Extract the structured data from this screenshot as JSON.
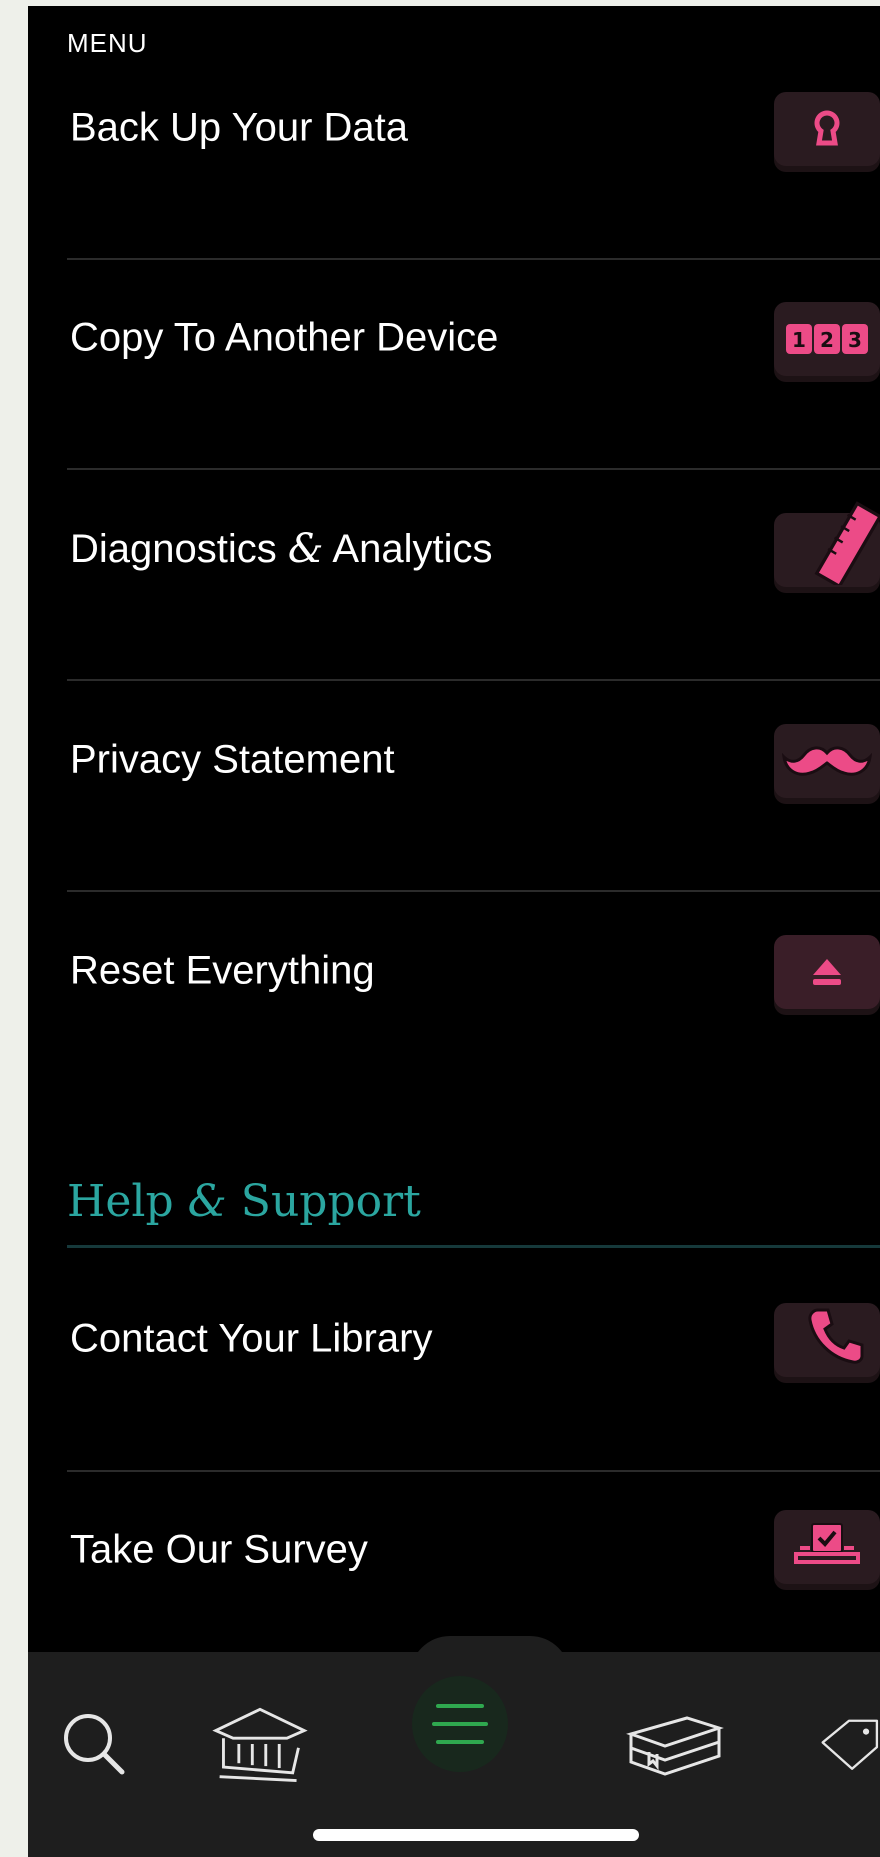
{
  "menu": {
    "title": "MENU"
  },
  "settings_items": [
    {
      "label": "Back Up Your Data",
      "icon": "keyhole-icon"
    },
    {
      "label": "Copy To Another Device",
      "icon": "numbers-123-icon"
    },
    {
      "label": "Diagnostics & Analytics",
      "icon": "ruler-icon"
    },
    {
      "label": "Privacy Statement",
      "icon": "mustache-icon"
    },
    {
      "label": "Reset Everything",
      "icon": "eject-icon"
    }
  ],
  "help_section": {
    "title": "Help & Support",
    "items": [
      {
        "label": "Contact Your Library",
        "icon": "phone-icon"
      },
      {
        "label": "Take Our Survey",
        "icon": "ballot-box-icon"
      }
    ]
  },
  "tab_bar": {
    "tabs": [
      {
        "icon": "search-icon"
      },
      {
        "icon": "library-icon"
      },
      {
        "icon": "menu-icon",
        "active": true
      },
      {
        "icon": "books-icon"
      },
      {
        "icon": "tag-icon"
      }
    ]
  },
  "colors": {
    "accent_pink": "#ec4b87",
    "section_teal": "#2ba6a0",
    "active_tab_green": "#2fa84f",
    "tile_bg": "#2a1b20"
  }
}
